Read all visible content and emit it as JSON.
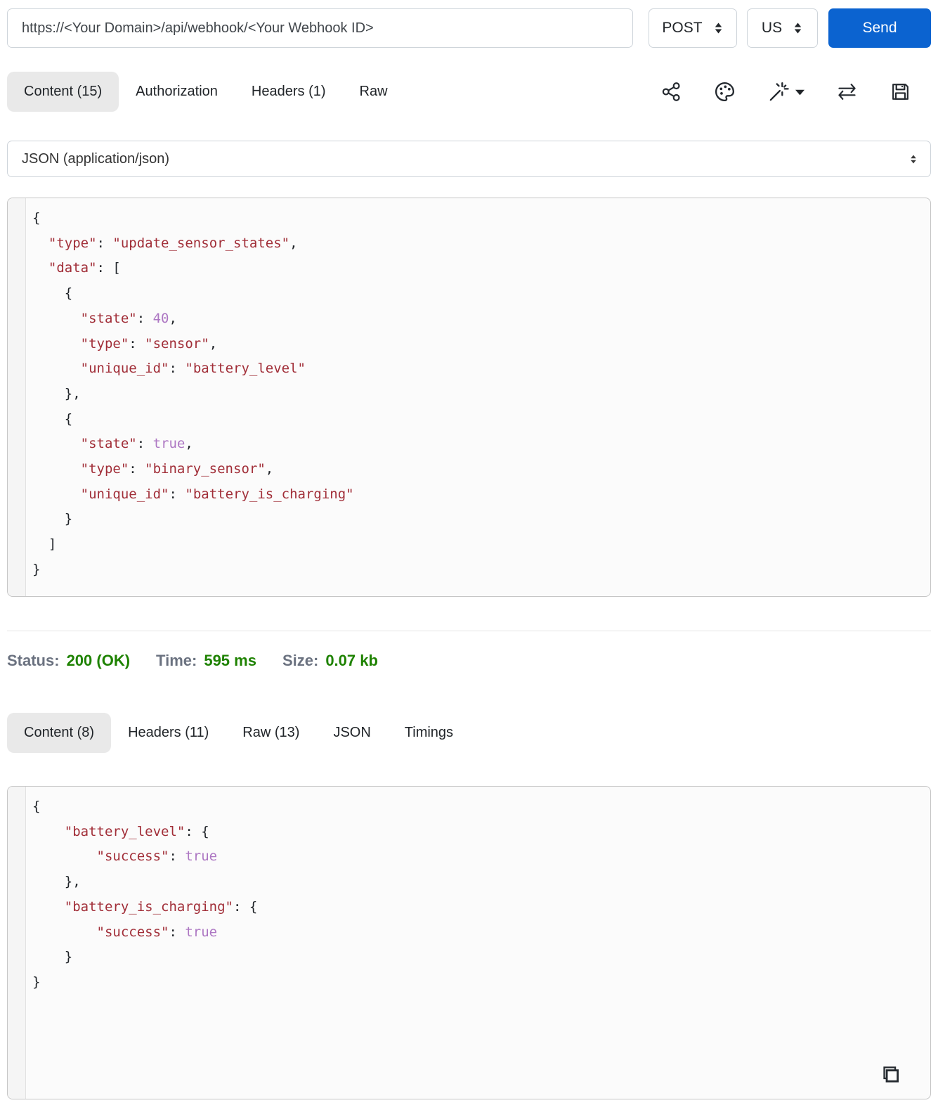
{
  "request_bar": {
    "url": "https://<Your Domain>/api/webhook/<Your Webhook ID>",
    "method": "POST",
    "region": "US",
    "send_label": "Send"
  },
  "request_tabs": [
    {
      "name": "tab-request-content",
      "label": "Content (15)",
      "active": true
    },
    {
      "name": "tab-request-authorization",
      "label": "Authorization",
      "active": false
    },
    {
      "name": "tab-request-headers",
      "label": "Headers (1)",
      "active": false
    },
    {
      "name": "tab-request-raw",
      "label": "Raw",
      "active": false
    }
  ],
  "toolbar_icons": [
    "share-icon",
    "palette-icon",
    "magic-wand-icon",
    "swap-arrows-icon",
    "save-icon"
  ],
  "content_type": {
    "selected": "JSON (application/json)"
  },
  "request_body_lines": [
    [
      [
        "p",
        "{"
      ]
    ],
    [
      [
        "p",
        "  "
      ],
      [
        "k",
        "\"type\""
      ],
      [
        "p",
        ": "
      ],
      [
        "s",
        "\"update_sensor_states\""
      ],
      [
        "p",
        ","
      ]
    ],
    [
      [
        "p",
        "  "
      ],
      [
        "k",
        "\"data\""
      ],
      [
        "p",
        ": ["
      ]
    ],
    [
      [
        "p",
        "    {"
      ]
    ],
    [
      [
        "p",
        "      "
      ],
      [
        "k",
        "\"state\""
      ],
      [
        "p",
        ": "
      ],
      [
        "n",
        "40"
      ],
      [
        "p",
        ","
      ]
    ],
    [
      [
        "p",
        "      "
      ],
      [
        "k",
        "\"type\""
      ],
      [
        "p",
        ": "
      ],
      [
        "s",
        "\"sensor\""
      ],
      [
        "p",
        ","
      ]
    ],
    [
      [
        "p",
        "      "
      ],
      [
        "k",
        "\"unique_id\""
      ],
      [
        "p",
        ": "
      ],
      [
        "s",
        "\"battery_level\""
      ]
    ],
    [
      [
        "p",
        "    },"
      ]
    ],
    [
      [
        "p",
        "    {"
      ]
    ],
    [
      [
        "p",
        "      "
      ],
      [
        "k",
        "\"state\""
      ],
      [
        "p",
        ": "
      ],
      [
        "b",
        "true"
      ],
      [
        "p",
        ","
      ]
    ],
    [
      [
        "p",
        "      "
      ],
      [
        "k",
        "\"type\""
      ],
      [
        "p",
        ": "
      ],
      [
        "s",
        "\"binary_sensor\""
      ],
      [
        "p",
        ","
      ]
    ],
    [
      [
        "p",
        "      "
      ],
      [
        "k",
        "\"unique_id\""
      ],
      [
        "p",
        ": "
      ],
      [
        "s",
        "\"battery_is_charging\""
      ]
    ],
    [
      [
        "p",
        "    }"
      ]
    ],
    [
      [
        "p",
        "  ]"
      ]
    ],
    [
      [
        "p",
        "}"
      ]
    ]
  ],
  "status_bar": {
    "status_label": "Status:",
    "status_value": "200 (OK)",
    "time_label": "Time:",
    "time_value": "595 ms",
    "size_label": "Size:",
    "size_value": "0.07 kb"
  },
  "response_tabs": [
    {
      "name": "tab-response-content",
      "label": "Content (8)",
      "active": true
    },
    {
      "name": "tab-response-headers",
      "label": "Headers (11)",
      "active": false
    },
    {
      "name": "tab-response-raw",
      "label": "Raw (13)",
      "active": false
    },
    {
      "name": "tab-response-json",
      "label": "JSON",
      "active": false
    },
    {
      "name": "tab-response-timings",
      "label": "Timings",
      "active": false
    }
  ],
  "response_body_lines": [
    [
      [
        "p",
        "{"
      ]
    ],
    [
      [
        "p",
        "    "
      ],
      [
        "k",
        "\"battery_level\""
      ],
      [
        "p",
        ": {"
      ]
    ],
    [
      [
        "p",
        "        "
      ],
      [
        "k",
        "\"success\""
      ],
      [
        "p",
        ": "
      ],
      [
        "b",
        "true"
      ]
    ],
    [
      [
        "p",
        "    },"
      ]
    ],
    [
      [
        "p",
        "    "
      ],
      [
        "k",
        "\"battery_is_charging\""
      ],
      [
        "p",
        ": {"
      ]
    ],
    [
      [
        "p",
        "        "
      ],
      [
        "k",
        "\"success\""
      ],
      [
        "p",
        ": "
      ],
      [
        "b",
        "true"
      ]
    ],
    [
      [
        "p",
        "    }"
      ]
    ],
    [
      [
        "p",
        "}"
      ]
    ]
  ],
  "colors": {
    "send_button": "#0b63d0",
    "status_green": "#1e8200",
    "status_label_grey": "#6b7280",
    "active_tab_bg": "#e9e9e9",
    "code_key_red": "#a12e38",
    "code_value_purple": "#ad77c3",
    "code_block_bg": "#fbfbfb",
    "code_block_border": "#c6c6c6"
  }
}
